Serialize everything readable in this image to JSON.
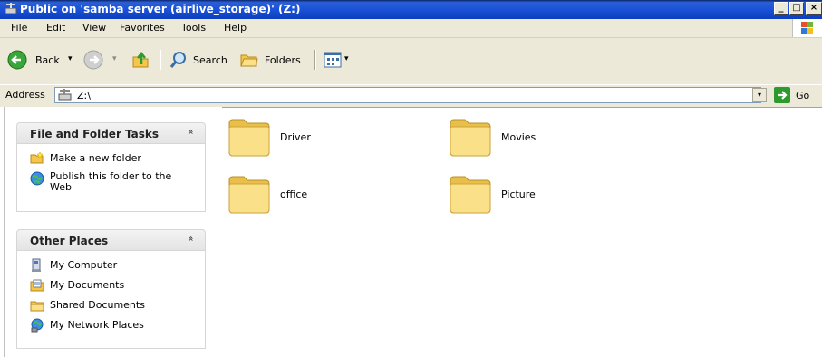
{
  "window": {
    "title": "Public on 'samba server (airlive_storage)' (Z:)",
    "min_glyph": "_",
    "max_glyph": "□",
    "close_glyph": "×"
  },
  "menubar": {
    "items": [
      "File",
      "Edit",
      "View",
      "Favorites",
      "Tools",
      "Help"
    ]
  },
  "toolbar": {
    "back_label": "Back",
    "search_label": "Search",
    "folders_label": "Folders",
    "dropdown_glyph": "▾"
  },
  "address": {
    "label": "Address",
    "value": "Z:\\",
    "go_label": "Go"
  },
  "tasks_panel": {
    "title": "File and Folder Tasks",
    "chevron": "»",
    "items": [
      {
        "label": "Make a new folder",
        "icon": "new-folder-icon"
      },
      {
        "label": "Publish this folder to the Web",
        "icon": "publish-web-icon"
      }
    ]
  },
  "places_panel": {
    "title": "Other Places",
    "chevron": "»",
    "items": [
      {
        "label": "My Computer",
        "icon": "my-computer-icon"
      },
      {
        "label": "My Documents",
        "icon": "my-documents-icon"
      },
      {
        "label": "Shared Documents",
        "icon": "shared-documents-icon"
      },
      {
        "label": "My Network Places",
        "icon": "network-places-icon"
      }
    ]
  },
  "folders": [
    {
      "name": "Driver"
    },
    {
      "name": "Movies"
    },
    {
      "name": "office"
    },
    {
      "name": "Picture"
    }
  ],
  "colors": {
    "title_bar": "#0c3fbf",
    "chrome": "#ece9d8",
    "folder_fill": "#f8d878"
  }
}
